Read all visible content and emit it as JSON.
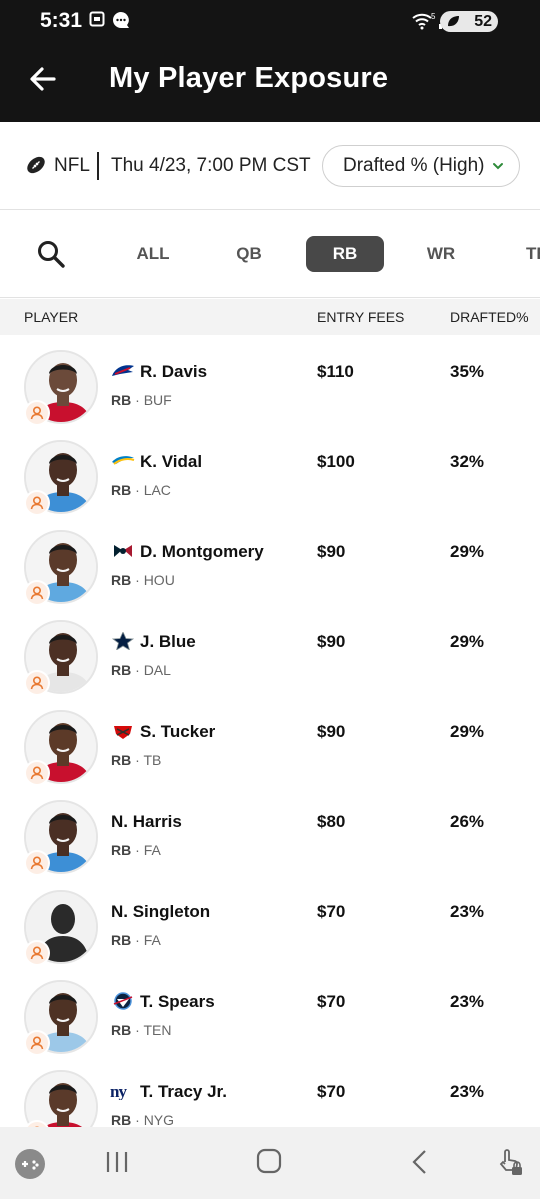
{
  "status": {
    "time": "5:31",
    "battery": "52",
    "wifi_label": "5"
  },
  "header": {
    "title": "My Player Exposure"
  },
  "contest": {
    "league": "NFL",
    "date": "Thu 4/23, 7:00 PM CST",
    "sort": "Drafted % (High)"
  },
  "tabs": [
    "ALL",
    "QB",
    "RB",
    "WR",
    "TE"
  ],
  "active_tab": "RB",
  "columns": {
    "player": "PLAYER",
    "fees": "ENTRY FEES",
    "drafted": "DRAFTED%"
  },
  "players": [
    {
      "name": "R. Davis",
      "pos": "RB",
      "team": "BUF",
      "fee": "$110",
      "pct": "35%",
      "skin": "#6b4a3a",
      "jersey": "#c8102e",
      "team_logo": "bills"
    },
    {
      "name": "K. Vidal",
      "pos": "RB",
      "team": "LAC",
      "fee": "$100",
      "pct": "32%",
      "skin": "#4a2f24",
      "jersey": "#3d8fd6",
      "team_logo": "chargers"
    },
    {
      "name": "D. Montgomery",
      "pos": "RB",
      "team": "HOU",
      "fee": "$90",
      "pct": "29%",
      "skin": "#5a3a2a",
      "jersey": "#5fa9e0",
      "team_logo": "texans"
    },
    {
      "name": "J. Blue",
      "pos": "RB",
      "team": "DAL",
      "fee": "$90",
      "pct": "29%",
      "skin": "#4c3024",
      "jersey": "#e6e6e6",
      "team_logo": "cowboys"
    },
    {
      "name": "S. Tucker",
      "pos": "RB",
      "team": "TB",
      "fee": "$90",
      "pct": "29%",
      "skin": "#5c3a28",
      "jersey": "#c8102e",
      "team_logo": "buccaneers"
    },
    {
      "name": "N. Harris",
      "pos": "RB",
      "team": "FA",
      "fee": "$80",
      "pct": "26%",
      "skin": "#4a2f24",
      "jersey": "#3d8fd6",
      "team_logo": ""
    },
    {
      "name": "N. Singleton",
      "pos": "RB",
      "team": "FA",
      "fee": "$70",
      "pct": "23%",
      "skin": "#333333",
      "jersey": "#333333",
      "team_logo": ""
    },
    {
      "name": "T. Spears",
      "pos": "RB",
      "team": "TEN",
      "fee": "$70",
      "pct": "23%",
      "skin": "#4e3224",
      "jersey": "#9cc8e8",
      "team_logo": "titans"
    },
    {
      "name": "T. Tracy Jr.",
      "pos": "RB",
      "team": "NYG",
      "fee": "$70",
      "pct": "23%",
      "skin": "#5a3a2a",
      "jersey": "#c8102e",
      "team_logo": "giants"
    }
  ],
  "icons": {
    "back": "arrow-left-icon",
    "search": "search-icon",
    "football": "football-icon",
    "chevron": "chevron-down-icon",
    "user_badge": "user-icon"
  },
  "colors": {
    "header_bg": "#141414",
    "active_tab": "#484848",
    "badge": "#e87830",
    "chevron": "#2e8b3a"
  }
}
